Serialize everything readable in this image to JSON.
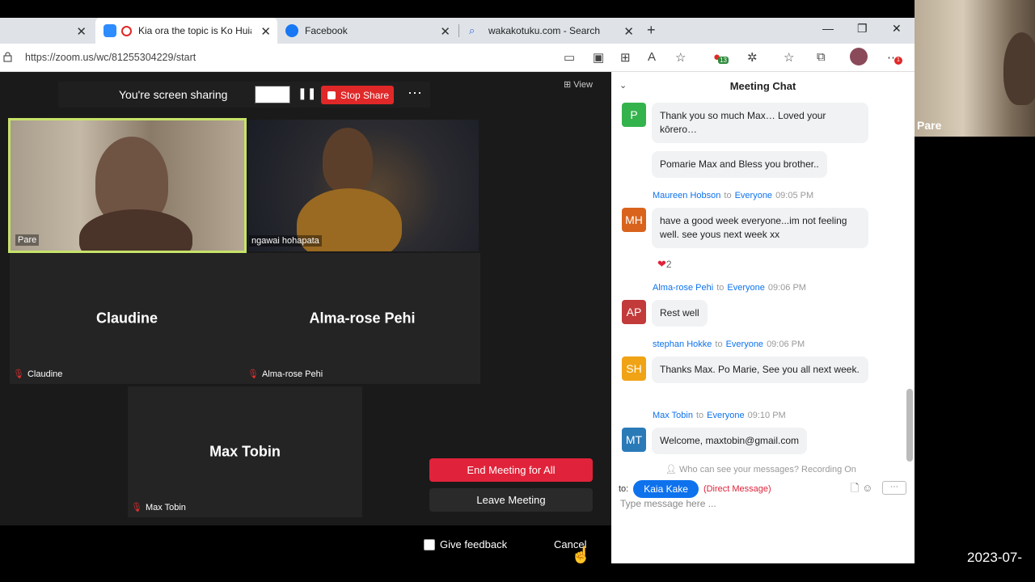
{
  "browser": {
    "tabs": [
      {
        "label": ""
      },
      {
        "label": "Kia ora the topic is Ko Huia"
      },
      {
        "label": "Facebook"
      },
      {
        "label": "wakakotuku.com - Search"
      }
    ],
    "url": "https://zoom.us/wc/81255304229/start",
    "ext_badge": "13",
    "notif_badge": "1"
  },
  "share_bar": {
    "text": "You're screen sharing",
    "stop_label": "Stop Share",
    "view_label": "View"
  },
  "participants": [
    {
      "name": "Pare",
      "video": true
    },
    {
      "name": "ngawai hohapata",
      "video": true
    },
    {
      "name": "Claudine",
      "video": false,
      "muted": true
    },
    {
      "name": "Alma-rose Pehi",
      "video": false,
      "muted": true
    },
    {
      "name": "Max Tobin",
      "video": false,
      "muted": true
    }
  ],
  "end_menu": {
    "end_all": "End Meeting for All",
    "leave": "Leave Meeting"
  },
  "bottom": {
    "feedback": "Give feedback",
    "cancel": "Cancel"
  },
  "chat": {
    "title": "Meeting Chat",
    "messages": [
      {
        "initials": "P",
        "color": "#34b34c",
        "sender": "",
        "to": "",
        "time": "",
        "text": "Thank you so much Max… Loved your kōrero…"
      },
      {
        "initials": "",
        "color": "",
        "sender": "",
        "to": "",
        "time": "",
        "text": "Pomarie Max and Bless you brother.."
      },
      {
        "initials": "MH",
        "color": "#d9631c",
        "sender": "Maureen Hobson",
        "to": "to",
        "recipient": "Everyone",
        "time": "09:05 PM",
        "text": "have a good week everyone...im not feeling well. see yous next week xx",
        "reaction": "2"
      },
      {
        "initials": "AP",
        "color": "#c23a3a",
        "sender": "Alma-rose Pehi",
        "to": "to",
        "recipient": "Everyone",
        "time": "09:06 PM",
        "text": "Rest well"
      },
      {
        "initials": "SH",
        "color": "#f0a314",
        "sender": "stephan Hokke",
        "to": "to",
        "recipient": "Everyone",
        "time": "09:06 PM",
        "text": "Thanks Max. Po Marie, See you all next week."
      },
      {
        "initials": "MT",
        "color": "#2a7ab8",
        "sender": "Max Tobin",
        "to": "to",
        "recipient": "Everyone",
        "time": "09:10 PM",
        "text": "Welcome, maxtobin@gmail.com"
      }
    ],
    "who_can_see": "Who can see your messages? Recording On",
    "to_label": "to:",
    "recipient": "Kaia Kake",
    "dm_label": "(Direct Message)",
    "placeholder": "Type message here ..."
  },
  "side_video": {
    "name": "Pare"
  },
  "timestamp": "2023-07-"
}
